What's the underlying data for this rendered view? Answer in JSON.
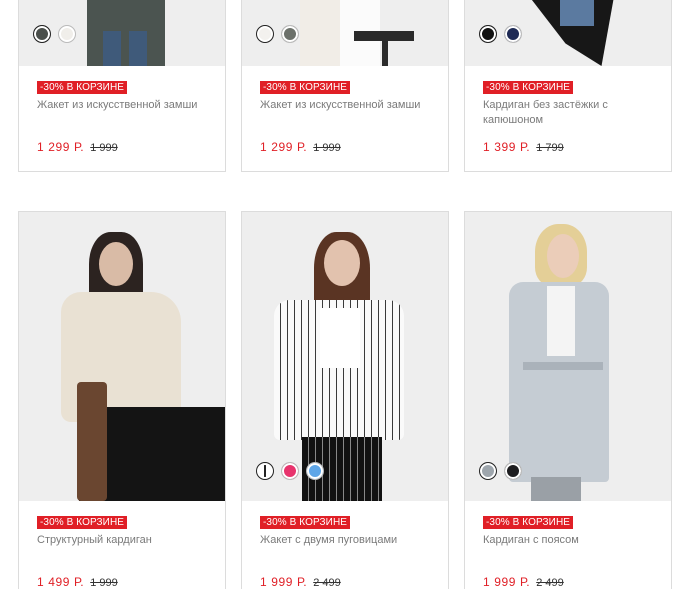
{
  "products": [
    {
      "badge": "-30% В КОРЗИНЕ",
      "title": "Жакет из искусственной замши",
      "price": "1 299 Р.",
      "old_price": "1 999",
      "swatches": [
        "#4a4f4b",
        "#f0eeea"
      ]
    },
    {
      "badge": "-30% В КОРЗИНЕ",
      "title": "Жакет из искусственной замши",
      "price": "1 299 Р.",
      "old_price": "1 999",
      "swatches": [
        "#f3f1ee",
        "#6c716b"
      ]
    },
    {
      "badge": "-30% В КОРЗИНЕ",
      "title": "Кардиган без застёжки с капюшоном",
      "price": "1 399 Р.",
      "old_price": "1 799",
      "swatches": [
        "#111111",
        "#1e2a55"
      ]
    },
    {
      "badge": "-30% В КОРЗИНЕ",
      "title": "Структурный кардиган",
      "price": "1 499 Р.",
      "old_price": "1 999",
      "swatches": []
    },
    {
      "badge": "-30% В КОРЗИНЕ",
      "title": "Жакет с двумя пуговицами",
      "price": "1 999 Р.",
      "old_price": "2 499",
      "swatches": [
        "#f5f5f5",
        "#e8336d",
        "#5ea6e8"
      ]
    },
    {
      "badge": "-30% В КОРЗИНЕ",
      "title": "Кардиган с поясом",
      "price": "1 999 Р.",
      "old_price": "2 499",
      "swatches": [
        "#9ea6ad",
        "#1d1d1f"
      ]
    }
  ],
  "colors": {
    "accent": "#e01f26",
    "card_border": "#dcdcdc",
    "title": "#7a7a7a"
  }
}
